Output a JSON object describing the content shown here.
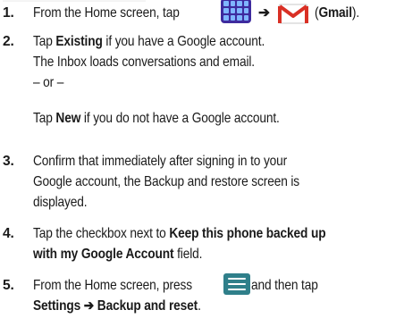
{
  "steps": [
    {
      "number": "1.",
      "parts": {
        "a": "From the Home screen, tap",
        "arrow": "➔",
        "gmail_open": "(",
        "gmail_label": "Gmail",
        "gmail_close": ")."
      }
    },
    {
      "number": "2.",
      "lines": {
        "l1_pre": "Tap ",
        "l1_bold": "Existing",
        "l1_post": " if you have a Google account.",
        "l2": "The Inbox loads conversations and email.",
        "l3": "– or –",
        "l4_pre": "Tap ",
        "l4_bold": "New",
        "l4_post": " if you do not have a Google account."
      }
    },
    {
      "number": "3.",
      "lines": {
        "l1": "Confirm that immediately after signing in to your",
        "l2": "Google account, the Backup and restore screen is",
        "l3": "displayed."
      }
    },
    {
      "number": "4.",
      "lines": {
        "l1_pre": "Tap the checkbox next to ",
        "l1_bold": "Keep this phone backed up",
        "l2_bold": "with my Google Account",
        "l2_post": " field."
      }
    },
    {
      "number": "5.",
      "lines": {
        "l1_pre": "From the Home screen, press",
        "l1_post": " and then tap",
        "l2_bold": "Settings ➔ Backup and reset",
        "l2_post": "."
      }
    }
  ],
  "icons": {
    "apps": "apps-grid-icon",
    "gmail": "gmail-icon",
    "menu": "menu-icon"
  },
  "colors": {
    "apps_icon_bg": "#3e2b9e",
    "gmail_red": "#d93025",
    "menu_icon_bg": "#2f7f8a"
  }
}
